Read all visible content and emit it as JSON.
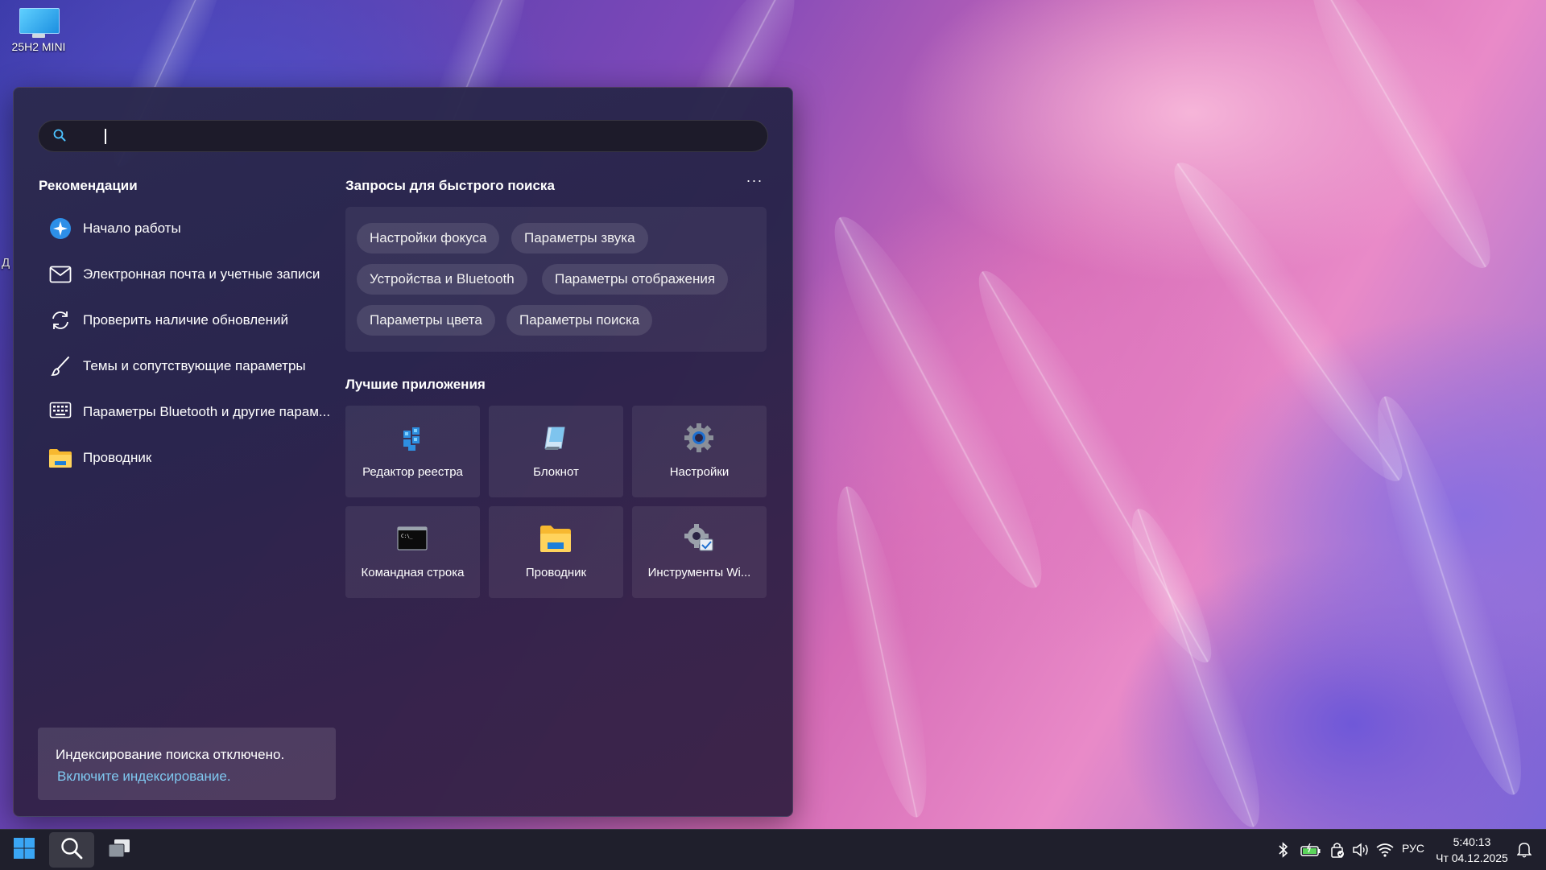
{
  "desktop": {
    "icon_label": "25H2 MINI",
    "edge_letter": "Д"
  },
  "search": {
    "value": "",
    "placeholder": ""
  },
  "recommendations": {
    "title": "Рекомендации",
    "items": [
      {
        "label": "Начало работы",
        "icon": "get-started-icon"
      },
      {
        "label": "Электронная почта и учетные записи",
        "icon": "mail-icon"
      },
      {
        "label": "Проверить наличие обновлений",
        "icon": "refresh-icon"
      },
      {
        "label": "Темы и сопутствующие параметры",
        "icon": "brush-icon"
      },
      {
        "label": "Параметры Bluetooth и другие парам...",
        "icon": "bluetooth-devices-icon"
      },
      {
        "label": "Проводник",
        "icon": "folder-icon"
      }
    ]
  },
  "quick_search": {
    "title": "Запросы для быстрого поиска",
    "more_label": "···",
    "chips": [
      "Настройки фокуса",
      "Параметры звука",
      "Устройства и Bluetooth",
      "Параметры отображения",
      "Параметры цвета",
      "Параметры поиска"
    ]
  },
  "top_apps": {
    "title": "Лучшие приложения",
    "apps": [
      {
        "label": "Редактор реестра",
        "icon": "registry-editor-icon"
      },
      {
        "label": "Блокнот",
        "icon": "notepad-icon"
      },
      {
        "label": "Настройки",
        "icon": "settings-gear-icon"
      },
      {
        "label": "Командная строка",
        "icon": "command-prompt-icon"
      },
      {
        "label": "Проводник",
        "icon": "file-explorer-icon"
      },
      {
        "label": "Инструменты Wi...",
        "icon": "windows-tools-icon"
      }
    ]
  },
  "indexing_notice": {
    "message": "Индексирование поиска отключено.",
    "link": "Включите индексирование."
  },
  "taskbar": {
    "language": "РУС",
    "time": "5:40:13",
    "date": "Чт 04.12.2025"
  },
  "colors": {
    "accent_link": "#7fc8f0",
    "search_accent": "#4cc2ff",
    "taskbar": "#1f1f2c"
  }
}
